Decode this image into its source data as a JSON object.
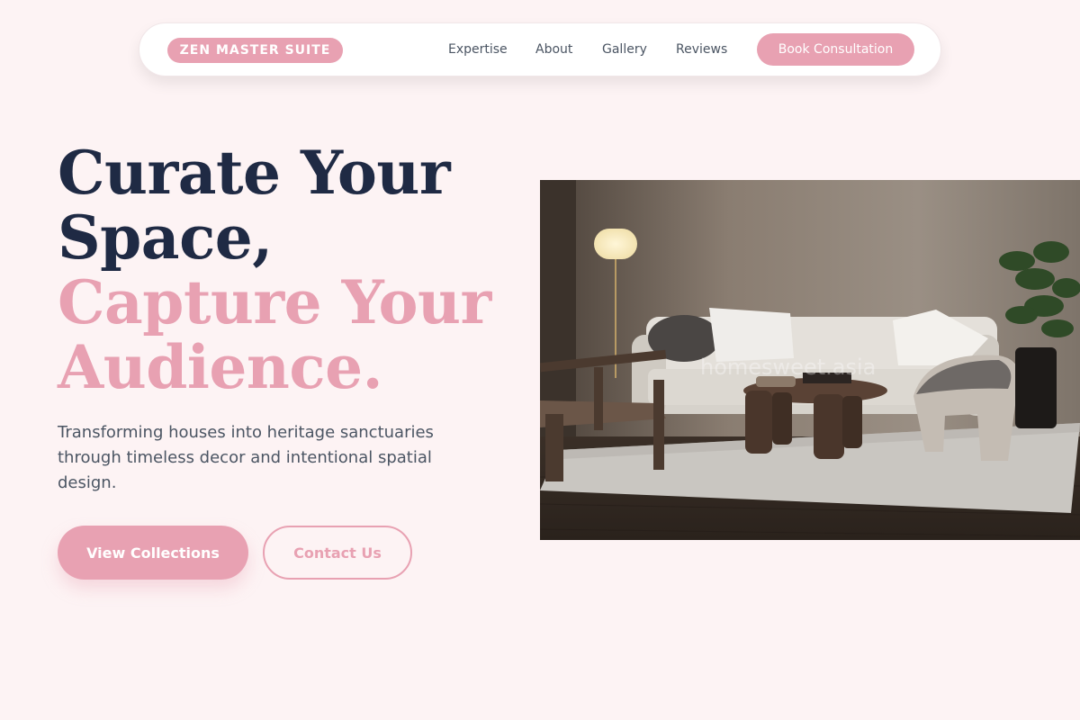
{
  "nav": {
    "brand": "ZEN MASTER SUITE",
    "links": [
      "Expertise",
      "About",
      "Gallery",
      "Reviews"
    ],
    "cta": "Book Consultation"
  },
  "hero": {
    "headline_dark_1": "Curate Your",
    "headline_dark_2": "Space,",
    "headline_pink_1": "Capture Your",
    "headline_pink_2": "Audience.",
    "subcopy": "Transforming houses into heritage sanctuaries through timeless decor and intentional spatial design.",
    "primary_button": "View Collections",
    "secondary_button": "Contact Us",
    "image_alt": "Living room with sofa, coffee table, lamp and plant",
    "watermark": "homesweet.asia"
  },
  "colors": {
    "background": "#fdf3f4",
    "accent_pink": "#e8a1b2",
    "heading_dark": "#1f2a44",
    "body_text": "#4b5563"
  }
}
